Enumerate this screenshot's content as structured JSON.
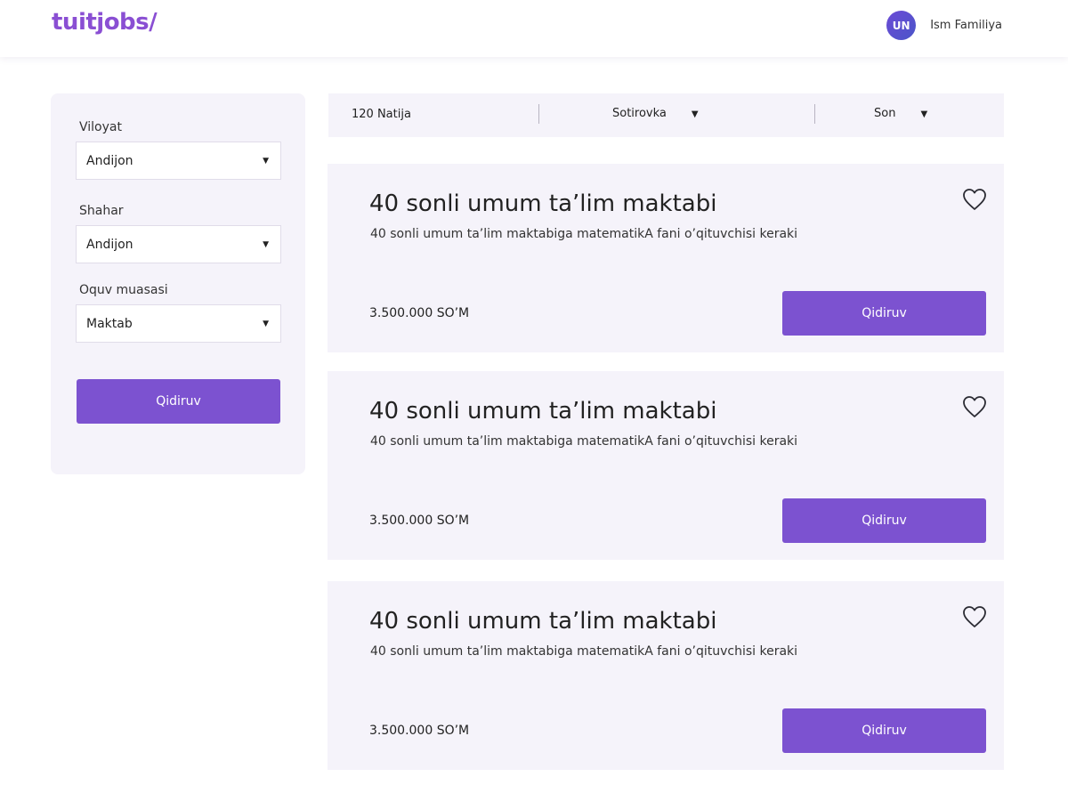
{
  "header": {
    "logo": "tuitjobs/",
    "user_initials": "UN",
    "user_name": "Ism Familiya"
  },
  "sidebar": {
    "fields": [
      {
        "label": "Viloyat",
        "value": "Andijon"
      },
      {
        "label": "Shahar",
        "value": "Andijon"
      },
      {
        "label": "Oquv muasasi",
        "value": "Maktab"
      }
    ],
    "search_button": "Qidiruv"
  },
  "filter_bar": {
    "results": "120 Natija",
    "sort_label": "Sotirovka",
    "order_label": "Son"
  },
  "cards": [
    {
      "title": "40 sonli umum ta’lim maktabi",
      "description": "40 sonli umum ta’lim maktabiga matematikA fani o’qituvchisi keraki",
      "salary": "3.500.000 SO’M",
      "button": "Qidiruv"
    },
    {
      "title": "40 sonli umum ta’lim maktabi",
      "description": "40 sonli umum ta’lim maktabiga matematikA fani o’qituvchisi keraki",
      "salary": "3.500.000 SO’M",
      "button": "Qidiruv"
    },
    {
      "title": "40 sonli umum ta’lim maktabi",
      "description": "40 sonli umum ta’lim maktabiga matematikA fani o’qituvchisi keraki",
      "salary": "3.500.000 SO’M",
      "button": "Qidiruv"
    }
  ],
  "icons": {
    "caret": "caret-down-icon",
    "favorite": "heart-icon"
  },
  "colors": {
    "accent": "#7c52d0",
    "logo": "#8a4fd3",
    "panel_bg": "#f5f3fa"
  }
}
